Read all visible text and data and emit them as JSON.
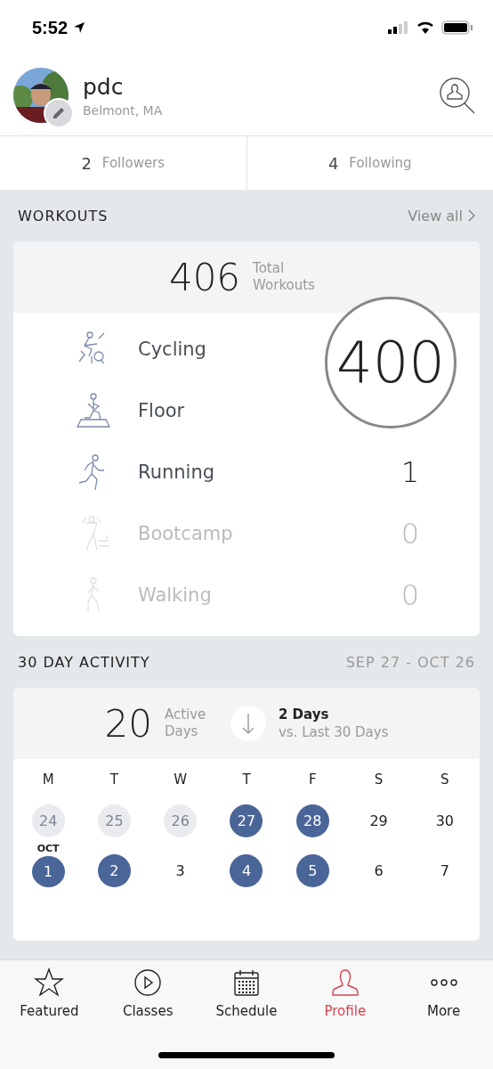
{
  "status_bar": {
    "time": "5:52"
  },
  "profile": {
    "name": "pdc",
    "location": "Belmont, MA"
  },
  "stats": [
    {
      "count": "2",
      "label": "Followers"
    },
    {
      "count": "4",
      "label": "Following"
    }
  ],
  "workouts": {
    "title": "WORKOUTS",
    "link": "View all",
    "total": "406",
    "total_label": "Total Workouts",
    "rows": [
      {
        "kind": "cycling",
        "name": "Cycling",
        "dimmed": false
      },
      {
        "kind": "floor",
        "name": "Floor",
        "dimmed": false
      },
      {
        "kind": "running",
        "name": "Running",
        "count": "1",
        "dimmed": false
      },
      {
        "kind": "bootcamp",
        "name": "Bootcamp",
        "count": "0",
        "dimmed": true
      },
      {
        "kind": "walking",
        "name": "Walking",
        "count": "0",
        "dimmed": true
      }
    ],
    "magnifier": "400"
  },
  "activity": {
    "title": "30 DAY ACTIVITY",
    "range": "SEP 27 - OCT 26",
    "active": "20",
    "active_label": "Active Days",
    "change": "2 Days",
    "change_label": "vs. Last 30 Days",
    "weekdays": [
      "M",
      "T",
      "W",
      "T",
      "F",
      "S",
      "S"
    ],
    "weeks": [
      [
        {
          "day": "24",
          "kind": "outside"
        },
        {
          "day": "25",
          "kind": "outside"
        },
        {
          "day": "26",
          "kind": "outside"
        },
        {
          "day": "27",
          "kind": "active"
        },
        {
          "day": "28",
          "kind": "active"
        },
        {
          "day": "29",
          "kind": "plain"
        },
        {
          "day": "30",
          "kind": "plain"
        }
      ],
      [
        {
          "day": "1",
          "kind": "active",
          "month": "OCT"
        },
        {
          "day": "2",
          "kind": "active"
        },
        {
          "day": "3",
          "kind": "plain"
        },
        {
          "day": "4",
          "kind": "active"
        },
        {
          "day": "5",
          "kind": "active"
        },
        {
          "day": "6",
          "kind": "plain"
        },
        {
          "day": "7",
          "kind": "plain"
        }
      ]
    ]
  },
  "tab_bar": [
    {
      "kind": "featured",
      "label": "Featured",
      "selected": false
    },
    {
      "kind": "classes",
      "label": "Classes",
      "selected": false
    },
    {
      "kind": "schedule",
      "label": "Schedule",
      "selected": false
    },
    {
      "kind": "profile",
      "label": "Profile",
      "selected": true
    },
    {
      "kind": "more",
      "label": "More",
      "selected": false
    }
  ]
}
